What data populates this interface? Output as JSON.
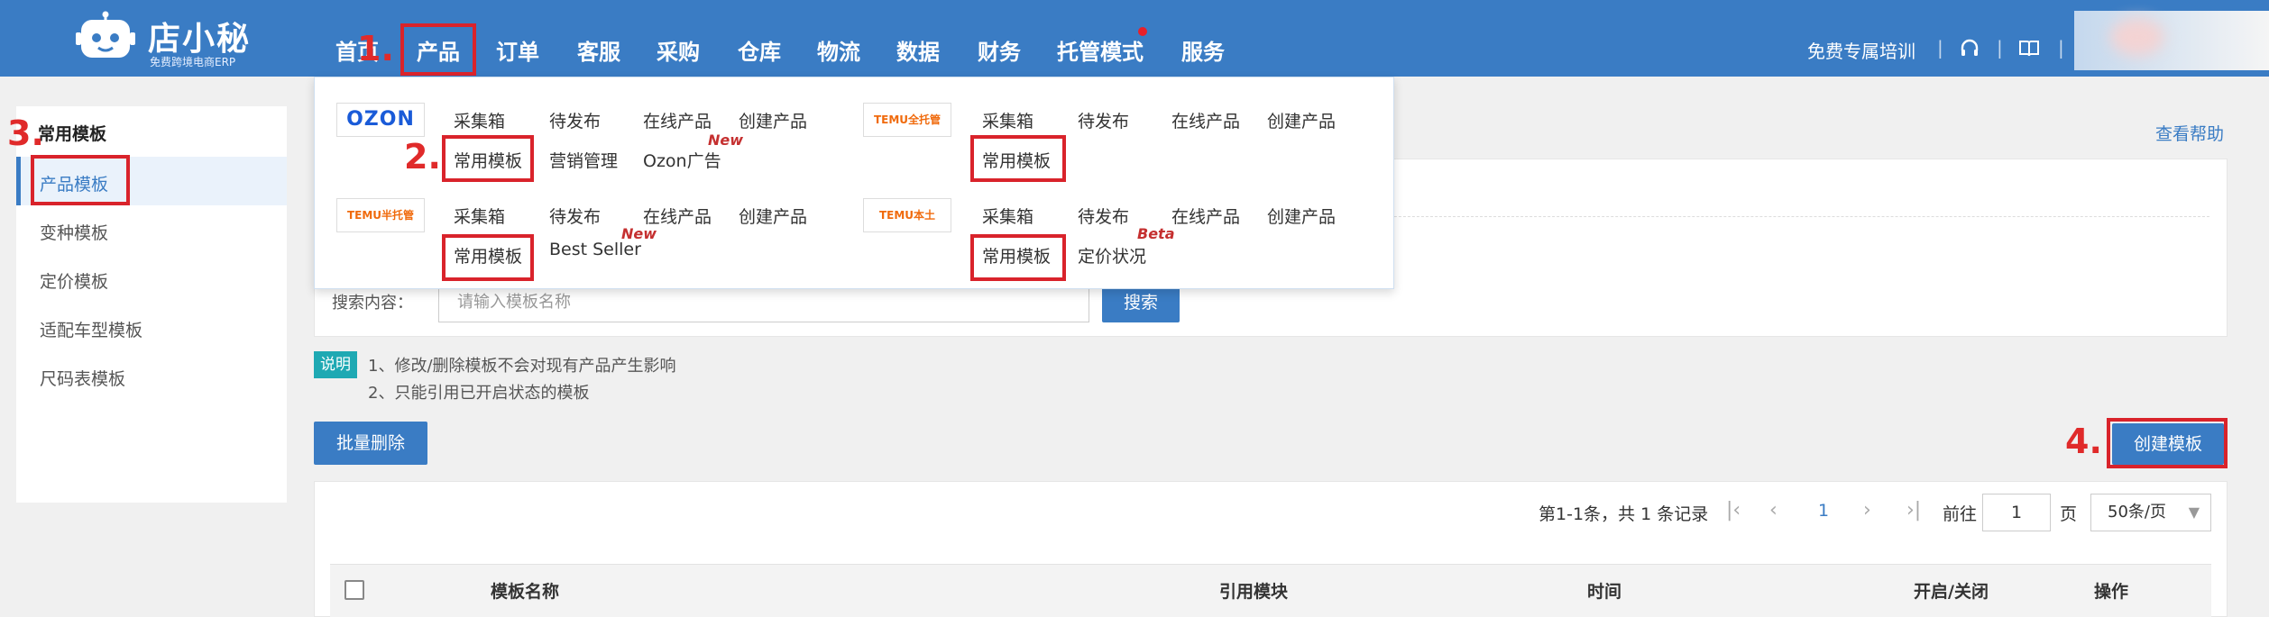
{
  "header": {
    "logo_name": "店小秘",
    "logo_sub": "免费跨境电商ERP",
    "nav": [
      "首页",
      "产品",
      "订单",
      "客服",
      "采购",
      "仓库",
      "物流",
      "数据",
      "财务",
      "托管模式",
      "服务"
    ],
    "training": "免费专属培训",
    "sep": "|",
    "icons": [
      "headset-icon",
      "book-icon"
    ]
  },
  "annotations": {
    "step1": "1.",
    "step2": "2.",
    "step3": "3.",
    "step4": "4."
  },
  "dropdown": {
    "ozon": {
      "logo": "OZON",
      "links": [
        "采集箱",
        "待发布",
        "在线产品",
        "创建产品"
      ],
      "row2": [
        "常用模板",
        "营销管理",
        "Ozon广告"
      ],
      "tag": "New"
    },
    "temu_full": {
      "logo": "TEMU全托管",
      "links": [
        "采集箱",
        "待发布",
        "在线产品",
        "创建产品"
      ],
      "row2": [
        "常用模板"
      ]
    },
    "temu_semi": {
      "logo": "TEMU半托管",
      "links": [
        "采集箱",
        "待发布",
        "在线产品",
        "创建产品"
      ],
      "row2": [
        "常用模板",
        "Best Seller"
      ],
      "tag": "New"
    },
    "temu_local": {
      "logo": "TEMU本土",
      "links": [
        "采集箱",
        "待发布",
        "在线产品",
        "创建产品"
      ],
      "row2": [
        "常用模板",
        "定价状况"
      ],
      "tag": "Beta"
    }
  },
  "sidebar": {
    "title": "常用模板",
    "items": [
      "产品模板",
      "变种模板",
      "定价模板",
      "适配车型模板",
      "尺码表模板"
    ]
  },
  "help_link": "查看帮助",
  "search": {
    "label": "搜索内容：",
    "placeholder": "请输入模板名称",
    "button": "搜索"
  },
  "notes": {
    "badge": "说明",
    "line1": "1、修改/删除模板不会对现有产品产生影响",
    "line2": "2、只能引用已开启状态的模板"
  },
  "actions": {
    "batch_delete": "批量删除",
    "create": "创建模板"
  },
  "pagination": {
    "summary": "第1-1条，共 1 条记录",
    "current_page": "1",
    "goto_label": "前往",
    "page_input": "1",
    "page_unit": "页",
    "page_size": "50条/页"
  },
  "table": {
    "columns": [
      "模板名称",
      "引用模块",
      "时间",
      "开启/关闭",
      "操作"
    ]
  },
  "colors": {
    "primary": "#3a7cc4",
    "annotation": "#d9232b",
    "badge": "#1ea9b3"
  }
}
